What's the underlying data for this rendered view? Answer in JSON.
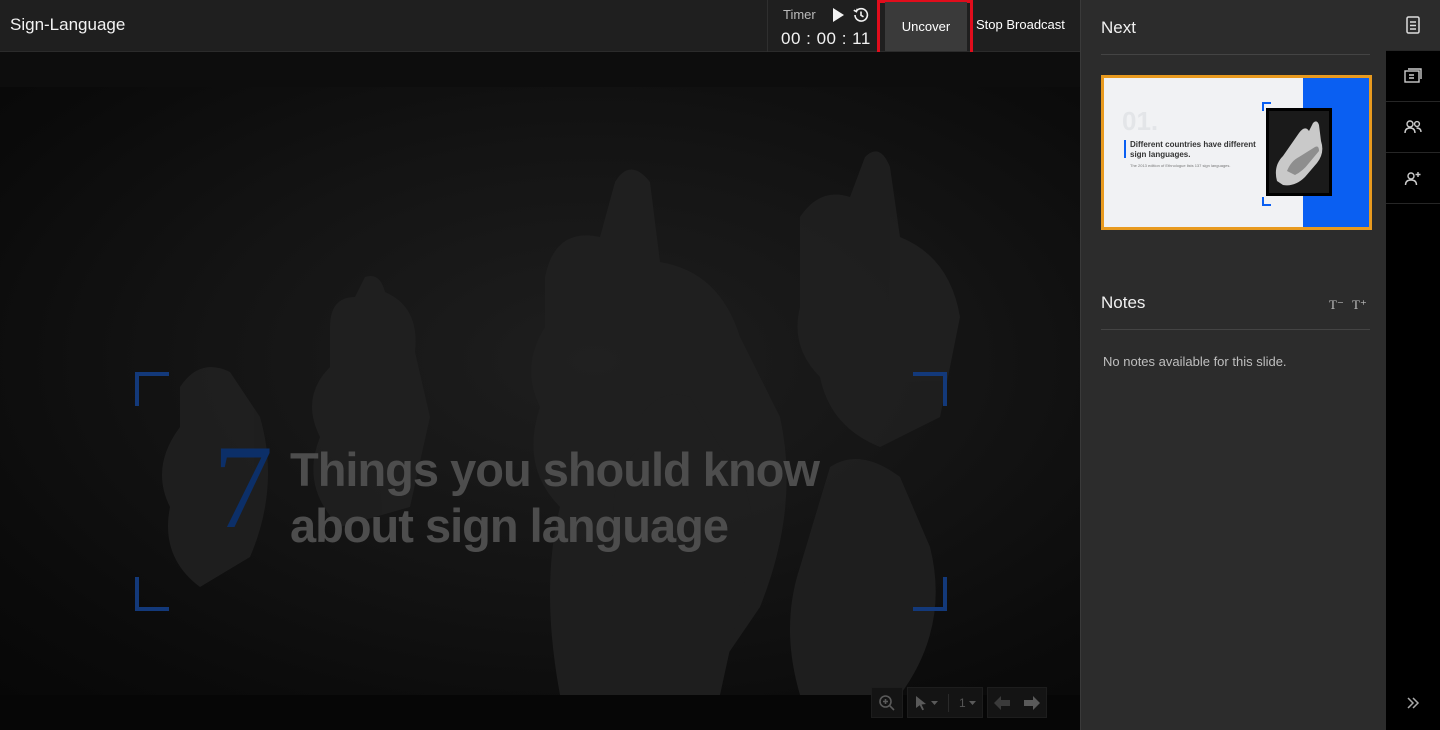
{
  "app": {
    "title": "Sign-Language"
  },
  "timer": {
    "label": "Timer",
    "value": "00 : 00 : 11",
    "play_icon": "play-icon",
    "reset_icon": "history-icon"
  },
  "toolbar": {
    "uncover_label": "Uncover",
    "stop_broadcast_label": "Stop Broadcast"
  },
  "slide": {
    "number": "7",
    "title_line1": "Things you should know",
    "title_line2": "about sign language",
    "accent_color": "#13397a"
  },
  "stage_tools": {
    "zoom_icon": "zoom-in-icon",
    "pointer_icon": "pointer-icon",
    "page_value": "1",
    "prev_icon": "arrow-left-icon",
    "next_icon": "arrow-right-icon"
  },
  "panel": {
    "next_heading": "Next",
    "next_slide": {
      "number": "01.",
      "title": "Different countries have different sign languages.",
      "subtitle": "The 2013 edition of Ethnologue lists 137 sign languages.",
      "border_color": "#e89a1f",
      "accent_color": "#0a5ff2"
    },
    "notes_heading": "Notes",
    "notes_decrease": "T⁻",
    "notes_increase": "T⁺",
    "notes_empty": "No notes available for this slide."
  },
  "rail": {
    "items": [
      "notes-document-icon",
      "slides-icon",
      "audience-icon",
      "add-user-icon"
    ],
    "collapse_icon": "double-chevron-right-icon"
  },
  "colors": {
    "highlight": "#e00d1c",
    "panel_bg": "#2c2c2c",
    "topbar_bg": "#1f1f1f"
  }
}
